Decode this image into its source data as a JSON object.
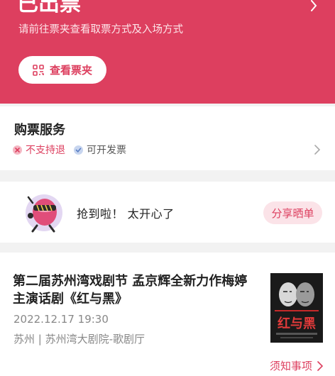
{
  "header": {
    "title": "已出票",
    "subtitle": "请前往票夹查看取票方式及入场方式",
    "ticket_wallet_button": "查看票夹"
  },
  "service": {
    "title": "购票服务",
    "tags": [
      {
        "label": "不支持退",
        "icon": "x-circle-icon",
        "color": "#dd3f5f"
      },
      {
        "label": "可开发票",
        "icon": "check-circle-icon",
        "color": "#8fa8d8"
      }
    ]
  },
  "share": {
    "text": "抢到啦！ 太开心了",
    "button": "分享晒单"
  },
  "show": {
    "title": "第二届苏州湾戏剧节 孟京辉全新力作梅婷主演话剧《红与黑》",
    "datetime": "2022.12.17 19:30",
    "venue": "苏州 | 苏州湾大剧院-歌剧厅",
    "poster_text": "红与黑",
    "notice_link": "须知事项"
  },
  "colors": {
    "accent": "#dd3f5f",
    "accent_light": "#fbe3e8",
    "muted_text": "#888888",
    "background": "#f2f2f2"
  }
}
